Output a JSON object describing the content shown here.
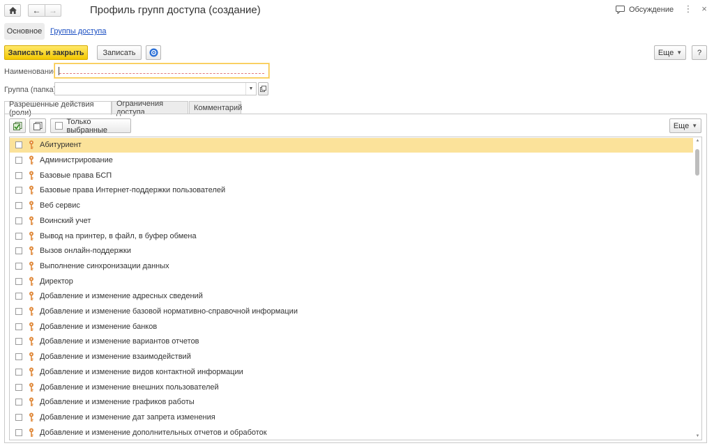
{
  "header": {
    "title": "Профиль групп доступа (создание)",
    "discussion_label": "Обсуждение"
  },
  "page_tabs": {
    "main": "Основное",
    "groups_link": "Группы доступа"
  },
  "toolbar": {
    "save_close": "Записать и закрыть",
    "save": "Записать",
    "more": "Еще",
    "help": "?"
  },
  "form": {
    "name_label": "Наименование:",
    "name_value": "",
    "group_label": "Группа (папка):",
    "group_value": ""
  },
  "inner_tabs": [
    {
      "label": "Разрешенные действия (роли)",
      "active": true
    },
    {
      "label": "Ограничения доступа",
      "active": false
    },
    {
      "label": "Комментарий",
      "active": false
    }
  ],
  "list_toolbar": {
    "only_selected": "Только выбранные",
    "more": "Еще"
  },
  "roles": [
    {
      "label": "Абитуриент",
      "selected": true,
      "checked": false
    },
    {
      "label": "Администрирование",
      "selected": false,
      "checked": false
    },
    {
      "label": "Базовые права БСП",
      "selected": false,
      "checked": false
    },
    {
      "label": "Базовые права Интернет-поддержки пользователей",
      "selected": false,
      "checked": false
    },
    {
      "label": "Веб сервис",
      "selected": false,
      "checked": false
    },
    {
      "label": "Воинский учет",
      "selected": false,
      "checked": false
    },
    {
      "label": "Вывод на принтер, в файл, в буфер обмена",
      "selected": false,
      "checked": false
    },
    {
      "label": "Вызов онлайн-поддержки",
      "selected": false,
      "checked": false
    },
    {
      "label": "Выполнение синхронизации данных",
      "selected": false,
      "checked": false
    },
    {
      "label": "Директор",
      "selected": false,
      "checked": false
    },
    {
      "label": "Добавление и изменение адресных сведений",
      "selected": false,
      "checked": false
    },
    {
      "label": "Добавление и изменение базовой нормативно-справочной информации",
      "selected": false,
      "checked": false
    },
    {
      "label": "Добавление и изменение банков",
      "selected": false,
      "checked": false
    },
    {
      "label": "Добавление и изменение вариантов отчетов",
      "selected": false,
      "checked": false
    },
    {
      "label": "Добавление и изменение взаимодействий",
      "selected": false,
      "checked": false
    },
    {
      "label": "Добавление и изменение видов контактной информации",
      "selected": false,
      "checked": false
    },
    {
      "label": "Добавление и изменение внешних пользователей",
      "selected": false,
      "checked": false
    },
    {
      "label": "Добавление и изменение графиков работы",
      "selected": false,
      "checked": false
    },
    {
      "label": "Добавление и изменение дат запрета изменения",
      "selected": false,
      "checked": false
    },
    {
      "label": "Добавление и изменение дополнительных отчетов и обработок",
      "selected": false,
      "checked": false
    }
  ],
  "colors": {
    "primary_button": "#f3c800",
    "selected_row": "#fbe29a",
    "link": "#1a4ec2",
    "key_icon": "#e0893a"
  }
}
